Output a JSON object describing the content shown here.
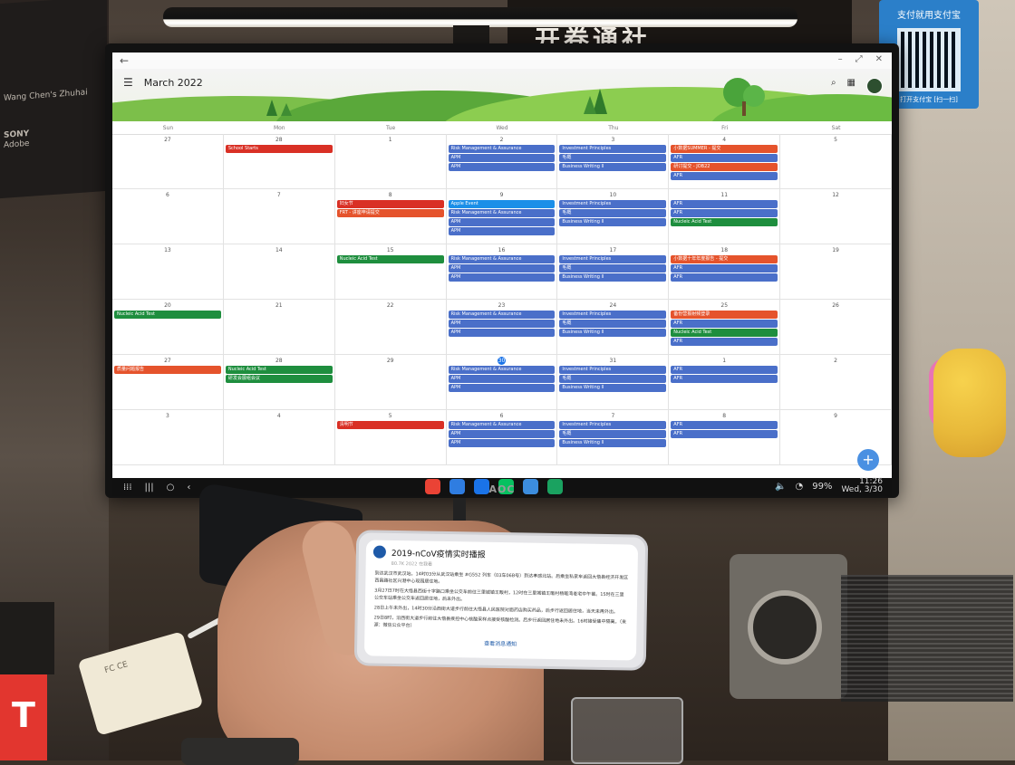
{
  "calendar": {
    "title": "March 2022",
    "weekdays": [
      "Sun",
      "Mon",
      "Tue",
      "Wed",
      "Thu",
      "Fri",
      "Sat"
    ],
    "fab_label": "+",
    "weeks": [
      [
        {
          "day": "27",
          "events": []
        },
        {
          "day": "28",
          "events": [
            {
              "label": "School Starts",
              "color": "#d93025"
            }
          ]
        },
        {
          "day": "1",
          "events": []
        },
        {
          "day": "2",
          "events": [
            {
              "label": "Risk Management & Assurance",
              "color": "#4a6fc9"
            },
            {
              "label": "APM",
              "color": "#4a6fc9"
            },
            {
              "label": "APM",
              "color": "#4a6fc9"
            }
          ]
        },
        {
          "day": "3",
          "events": [
            {
              "label": "Investment Principles",
              "color": "#4a6fc9"
            },
            {
              "label": "毛概",
              "color": "#4a6fc9"
            },
            {
              "label": "Business Writing II",
              "color": "#4a6fc9"
            }
          ]
        },
        {
          "day": "4",
          "events": [
            {
              "label": "小数据SUMMER - 提交",
              "color": "#e5532c"
            },
            {
              "label": "AFR",
              "color": "#4a6fc9"
            },
            {
              "label": "研讨提交 - JOB22",
              "color": "#e5532c"
            },
            {
              "label": "AFR",
              "color": "#4a6fc9"
            }
          ]
        },
        {
          "day": "5",
          "events": []
        }
      ],
      [
        {
          "day": "6",
          "events": []
        },
        {
          "day": "7",
          "events": []
        },
        {
          "day": "8",
          "events": [
            {
              "label": "妇女节",
              "color": "#d93025"
            },
            {
              "label": "FRT - 讲座申请提交",
              "color": "#e5532c"
            }
          ]
        },
        {
          "day": "9",
          "events": [
            {
              "label": "Apple Event",
              "color": "#1a8fe8"
            },
            {
              "label": "Risk Management & Assurance",
              "color": "#4a6fc9"
            },
            {
              "label": "APM",
              "color": "#4a6fc9"
            },
            {
              "label": "APM",
              "color": "#4a6fc9"
            }
          ]
        },
        {
          "day": "10",
          "events": [
            {
              "label": "Investment Principles",
              "color": "#4a6fc9"
            },
            {
              "label": "毛概",
              "color": "#4a6fc9"
            },
            {
              "label": "Business Writing II",
              "color": "#4a6fc9"
            }
          ]
        },
        {
          "day": "11",
          "events": [
            {
              "label": "AFR",
              "color": "#4a6fc9"
            },
            {
              "label": "AFR",
              "color": "#4a6fc9"
            },
            {
              "label": "Nucleic Acid Test",
              "color": "#1e8e3e"
            }
          ]
        },
        {
          "day": "12",
          "events": []
        }
      ],
      [
        {
          "day": "13",
          "events": []
        },
        {
          "day": "14",
          "events": []
        },
        {
          "day": "15",
          "events": [
            {
              "label": "Nucleic Acid Test",
              "color": "#1e8e3e"
            }
          ]
        },
        {
          "day": "16",
          "events": [
            {
              "label": "Risk Management & Assurance",
              "color": "#4a6fc9"
            },
            {
              "label": "APM",
              "color": "#4a6fc9"
            },
            {
              "label": "APM",
              "color": "#4a6fc9"
            }
          ]
        },
        {
          "day": "17",
          "events": [
            {
              "label": "Investment Principles",
              "color": "#4a6fc9"
            },
            {
              "label": "毛概",
              "color": "#4a6fc9"
            },
            {
              "label": "Business Writing II",
              "color": "#4a6fc9"
            }
          ]
        },
        {
          "day": "18",
          "events": [
            {
              "label": "小数据十年年度报告 - 提交",
              "color": "#e5532c"
            },
            {
              "label": "AFR",
              "color": "#4a6fc9"
            },
            {
              "label": "AFR",
              "color": "#4a6fc9"
            }
          ]
        },
        {
          "day": "19",
          "events": []
        }
      ],
      [
        {
          "day": "20",
          "events": [
            {
              "label": "Nucleic Acid Test",
              "color": "#1e8e3e"
            }
          ]
        },
        {
          "day": "21",
          "events": []
        },
        {
          "day": "22",
          "events": []
        },
        {
          "day": "23",
          "events": [
            {
              "label": "Risk Management & Assurance",
              "color": "#4a6fc9"
            },
            {
              "label": "APM",
              "color": "#4a6fc9"
            },
            {
              "label": "APM",
              "color": "#4a6fc9"
            }
          ]
        },
        {
          "day": "24",
          "events": [
            {
              "label": "Investment Principles",
              "color": "#4a6fc9"
            },
            {
              "label": "毛概",
              "color": "#4a6fc9"
            },
            {
              "label": "Business Writing II",
              "color": "#4a6fc9"
            }
          ]
        },
        {
          "day": "25",
          "events": [
            {
              "label": "备份营报射频登录",
              "color": "#e5532c"
            },
            {
              "label": "AFR",
              "color": "#4a6fc9"
            },
            {
              "label": "Nucleic Acid Test",
              "color": "#1e8e3e"
            },
            {
              "label": "AFR",
              "color": "#4a6fc9"
            }
          ]
        },
        {
          "day": "26",
          "events": []
        }
      ],
      [
        {
          "day": "27",
          "events": [
            {
              "label": "质量问题报告",
              "color": "#e5532c"
            }
          ]
        },
        {
          "day": "28",
          "events": [
            {
              "label": "Nucleic Acid Test",
              "color": "#1e8e3e"
            },
            {
              "label": "研发会展组会议",
              "color": "#1e8e3e"
            }
          ]
        },
        {
          "day": "29",
          "events": []
        },
        {
          "day": "30",
          "today": true,
          "events": [
            {
              "label": "Risk Management & Assurance",
              "color": "#4a6fc9"
            },
            {
              "label": "APM",
              "color": "#4a6fc9"
            },
            {
              "label": "APM",
              "color": "#4a6fc9"
            }
          ]
        },
        {
          "day": "31",
          "events": [
            {
              "label": "Investment Principles",
              "color": "#4a6fc9"
            },
            {
              "label": "毛概",
              "color": "#4a6fc9"
            },
            {
              "label": "Business Writing II",
              "color": "#4a6fc9"
            }
          ]
        },
        {
          "day": "1",
          "events": [
            {
              "label": "AFR",
              "color": "#4a6fc9"
            },
            {
              "label": "AFR",
              "color": "#4a6fc9"
            }
          ]
        },
        {
          "day": "2",
          "events": []
        }
      ],
      [
        {
          "day": "3",
          "events": []
        },
        {
          "day": "4",
          "events": []
        },
        {
          "day": "5",
          "events": [
            {
              "label": "清明节",
              "color": "#d93025"
            }
          ]
        },
        {
          "day": "6",
          "events": [
            {
              "label": "Risk Management & Assurance",
              "color": "#4a6fc9"
            },
            {
              "label": "APM",
              "color": "#4a6fc9"
            },
            {
              "label": "APM",
              "color": "#4a6fc9"
            }
          ]
        },
        {
          "day": "7",
          "events": [
            {
              "label": "Investment Principles",
              "color": "#4a6fc9"
            },
            {
              "label": "毛概",
              "color": "#4a6fc9"
            },
            {
              "label": "Business Writing II",
              "color": "#4a6fc9"
            }
          ]
        },
        {
          "day": "8",
          "events": [
            {
              "label": "AFR",
              "color": "#4a6fc9"
            },
            {
              "label": "AFR",
              "color": "#4a6fc9"
            }
          ]
        },
        {
          "day": "9",
          "events": []
        }
      ]
    ]
  },
  "taskbar": {
    "time": "11:26",
    "date": "Wed, 3/30",
    "battery": "99%",
    "app_colors": [
      "#ea4335",
      "#2f7de1",
      "#1a73e8",
      "#07c160",
      "#3c8dde",
      "#1aa260"
    ]
  },
  "monitor": {
    "brand": "AOC"
  },
  "phone": {
    "title": "2019-nCoV疫情实时播报",
    "subtitle": "80.7K 2022  在我看",
    "paragraphs": [
      "到达武汉市武汉站。14时03分从武汉站乘坐 #G552 列车（03车06B号）到达孝感北站。后乘坐私家车返回大悟县经济开发区西昌路社区兴港中心现园居住地。",
      "3月27日7时在大悟县西街十字路口乘坐公交车前往三里城镇王畈村，12时在三里城镇王畈村杨畈湾老宅中午餐。15时在三里公交车站乘坐公交车返回居住地，后未外出。",
      "28日上午未外出，14时30分沿西街大道步行前往大悟县人民医院对面药店购买药品，后步行返回居住地，当天未再外出。",
      "29日8时，沿西街大道步行前往大悟县疾控中心核酸采样点接受核酸检测。后步行返回居住地未外出。16时接受集中隔离。（来源：微信公众平台）"
    ],
    "link": "查看消息通知"
  },
  "decor": {
    "banner_text": "开卷通社",
    "qr_caption": "支付就用支付宝",
    "qr_sub": "打开支付宝 [扫一扫]",
    "charger_text": "FC CE",
    "red_box_text": "T",
    "poster_lines": [
      "SONY",
      "Adobe",
      "Wang Chen's Zhuhai"
    ]
  }
}
